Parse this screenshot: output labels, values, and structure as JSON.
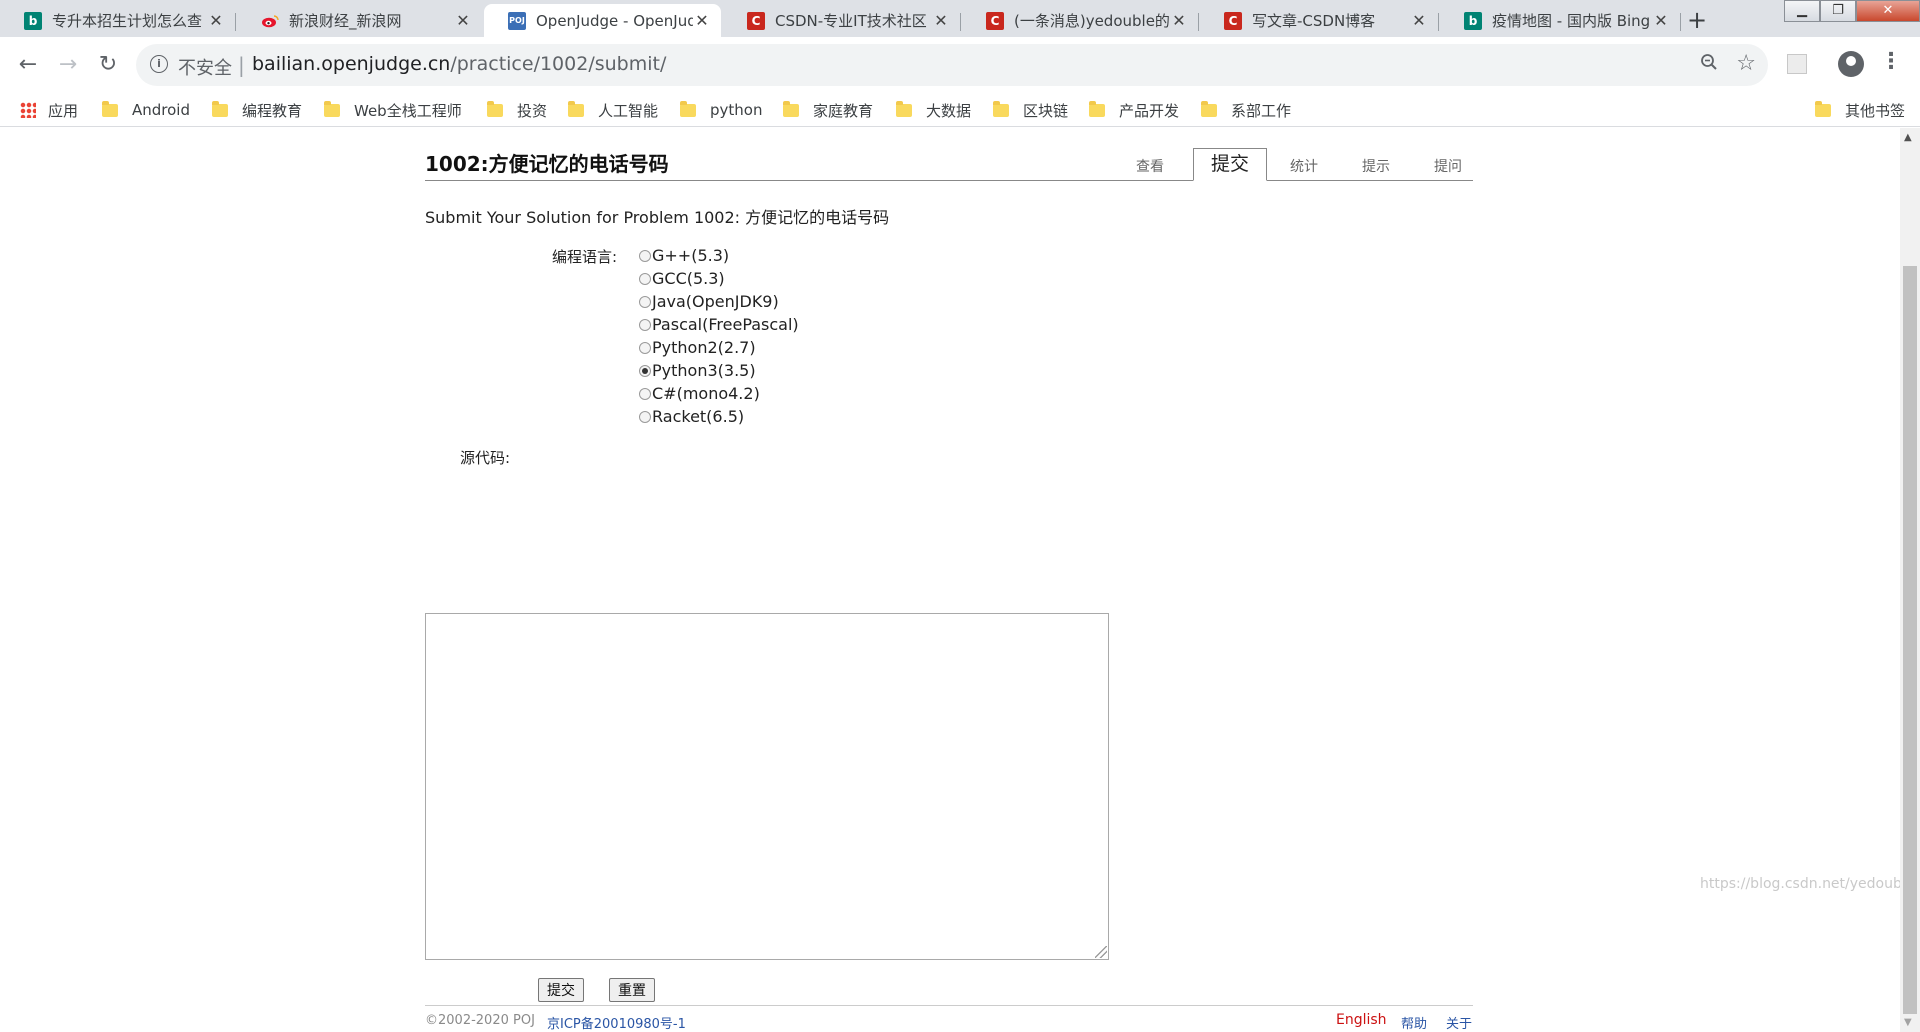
{
  "browser": {
    "tabs": [
      {
        "title": "专升本招生计划怎么查",
        "icon": "bing",
        "active": false
      },
      {
        "title": "新浪财经_新浪网",
        "icon": "weibo",
        "active": false
      },
      {
        "title": "OpenJudge - OpenJudge",
        "icon": "poj",
        "active": true
      },
      {
        "title": "CSDN-专业IT技术社区",
        "icon": "csdn",
        "active": false
      },
      {
        "title": "(一条消息)yedouble的博客",
        "icon": "csdn",
        "active": false
      },
      {
        "title": "写文章-CSDN博客",
        "icon": "csdn",
        "active": false
      },
      {
        "title": "疫情地图 - 国内版 Bing",
        "icon": "bing",
        "active": false
      }
    ],
    "tab_icon_text": {
      "bing": "b",
      "poj": "POJ",
      "csdn": "C"
    },
    "address": {
      "security_label": "不安全",
      "separator": "|",
      "host": "bailian.openjudge.cn",
      "path": "/practice/1002/submit/"
    },
    "bookmarks": {
      "apps": "应用",
      "folders": [
        "Android",
        "编程教育",
        "Web全栈工程师",
        "投资",
        "人工智能",
        "python",
        "家庭教育",
        "大数据",
        "区块链",
        "产品开发",
        "系部工作"
      ],
      "other": "其他书签"
    },
    "colors": {
      "bing": "#008373",
      "csdn": "#c9271d",
      "weibo": "#e6162d",
      "poj": "#3b6fb6"
    }
  },
  "page": {
    "problem_title": "1002:方便记忆的电话号码",
    "problem_tabs": [
      {
        "label": "查看",
        "active": false
      },
      {
        "label": "提交",
        "active": true
      },
      {
        "label": "统计",
        "active": false
      },
      {
        "label": "提示",
        "active": false
      },
      {
        "label": "提问",
        "active": false
      }
    ],
    "submit_heading": "Submit Your Solution for Problem 1002: 方便记忆的电话号码",
    "language_label": "编程语言:",
    "languages": [
      {
        "label": "G++(5.3)",
        "checked": false
      },
      {
        "label": "GCC(5.3)",
        "checked": false
      },
      {
        "label": "Java(OpenJDK9)",
        "checked": false
      },
      {
        "label": "Pascal(FreePascal)",
        "checked": false
      },
      {
        "label": "Python2(2.7)",
        "checked": false
      },
      {
        "label": "Python3(3.5)",
        "checked": true
      },
      {
        "label": "C#(mono4.2)",
        "checked": false
      },
      {
        "label": "Racket(6.5)",
        "checked": false
      }
    ],
    "source_label": "源代码:",
    "source_value": "",
    "submit_button": "提交",
    "reset_button": "重置",
    "footer": {
      "copyright": "©2002-2020 POJ",
      "icp": "京ICP备20010980号-1",
      "links": [
        "English",
        "帮助",
        "关于"
      ]
    },
    "watermark": "https://blog.csdn.net/yedouble"
  }
}
